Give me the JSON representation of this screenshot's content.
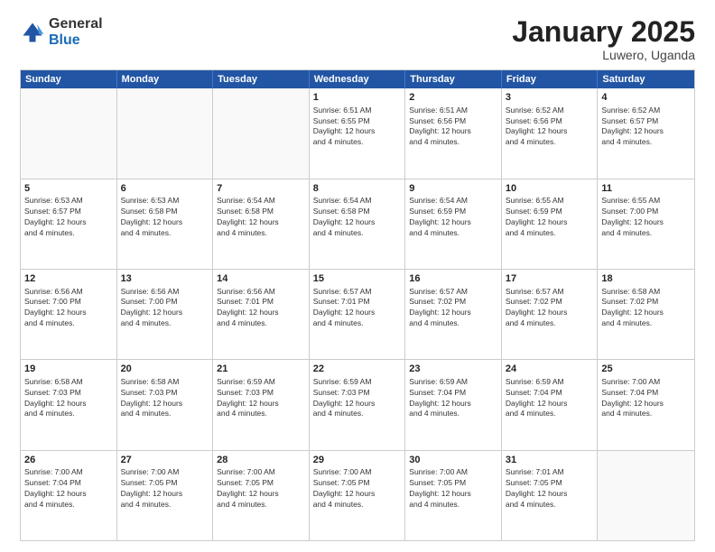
{
  "logo": {
    "general": "General",
    "blue": "Blue"
  },
  "title": {
    "month": "January 2025",
    "location": "Luwero, Uganda"
  },
  "header_days": [
    "Sunday",
    "Monday",
    "Tuesday",
    "Wednesday",
    "Thursday",
    "Friday",
    "Saturday"
  ],
  "rows": [
    [
      {
        "day": "",
        "text": "",
        "empty": true
      },
      {
        "day": "",
        "text": "",
        "empty": true
      },
      {
        "day": "",
        "text": "",
        "empty": true
      },
      {
        "day": "1",
        "text": "Sunrise: 6:51 AM\nSunset: 6:55 PM\nDaylight: 12 hours\nand 4 minutes."
      },
      {
        "day": "2",
        "text": "Sunrise: 6:51 AM\nSunset: 6:56 PM\nDaylight: 12 hours\nand 4 minutes."
      },
      {
        "day": "3",
        "text": "Sunrise: 6:52 AM\nSunset: 6:56 PM\nDaylight: 12 hours\nand 4 minutes."
      },
      {
        "day": "4",
        "text": "Sunrise: 6:52 AM\nSunset: 6:57 PM\nDaylight: 12 hours\nand 4 minutes."
      }
    ],
    [
      {
        "day": "5",
        "text": "Sunrise: 6:53 AM\nSunset: 6:57 PM\nDaylight: 12 hours\nand 4 minutes."
      },
      {
        "day": "6",
        "text": "Sunrise: 6:53 AM\nSunset: 6:58 PM\nDaylight: 12 hours\nand 4 minutes."
      },
      {
        "day": "7",
        "text": "Sunrise: 6:54 AM\nSunset: 6:58 PM\nDaylight: 12 hours\nand 4 minutes."
      },
      {
        "day": "8",
        "text": "Sunrise: 6:54 AM\nSunset: 6:58 PM\nDaylight: 12 hours\nand 4 minutes."
      },
      {
        "day": "9",
        "text": "Sunrise: 6:54 AM\nSunset: 6:59 PM\nDaylight: 12 hours\nand 4 minutes."
      },
      {
        "day": "10",
        "text": "Sunrise: 6:55 AM\nSunset: 6:59 PM\nDaylight: 12 hours\nand 4 minutes."
      },
      {
        "day": "11",
        "text": "Sunrise: 6:55 AM\nSunset: 7:00 PM\nDaylight: 12 hours\nand 4 minutes."
      }
    ],
    [
      {
        "day": "12",
        "text": "Sunrise: 6:56 AM\nSunset: 7:00 PM\nDaylight: 12 hours\nand 4 minutes."
      },
      {
        "day": "13",
        "text": "Sunrise: 6:56 AM\nSunset: 7:00 PM\nDaylight: 12 hours\nand 4 minutes."
      },
      {
        "day": "14",
        "text": "Sunrise: 6:56 AM\nSunset: 7:01 PM\nDaylight: 12 hours\nand 4 minutes."
      },
      {
        "day": "15",
        "text": "Sunrise: 6:57 AM\nSunset: 7:01 PM\nDaylight: 12 hours\nand 4 minutes."
      },
      {
        "day": "16",
        "text": "Sunrise: 6:57 AM\nSunset: 7:02 PM\nDaylight: 12 hours\nand 4 minutes."
      },
      {
        "day": "17",
        "text": "Sunrise: 6:57 AM\nSunset: 7:02 PM\nDaylight: 12 hours\nand 4 minutes."
      },
      {
        "day": "18",
        "text": "Sunrise: 6:58 AM\nSunset: 7:02 PM\nDaylight: 12 hours\nand 4 minutes."
      }
    ],
    [
      {
        "day": "19",
        "text": "Sunrise: 6:58 AM\nSunset: 7:03 PM\nDaylight: 12 hours\nand 4 minutes."
      },
      {
        "day": "20",
        "text": "Sunrise: 6:58 AM\nSunset: 7:03 PM\nDaylight: 12 hours\nand 4 minutes."
      },
      {
        "day": "21",
        "text": "Sunrise: 6:59 AM\nSunset: 7:03 PM\nDaylight: 12 hours\nand 4 minutes."
      },
      {
        "day": "22",
        "text": "Sunrise: 6:59 AM\nSunset: 7:03 PM\nDaylight: 12 hours\nand 4 minutes."
      },
      {
        "day": "23",
        "text": "Sunrise: 6:59 AM\nSunset: 7:04 PM\nDaylight: 12 hours\nand 4 minutes."
      },
      {
        "day": "24",
        "text": "Sunrise: 6:59 AM\nSunset: 7:04 PM\nDaylight: 12 hours\nand 4 minutes."
      },
      {
        "day": "25",
        "text": "Sunrise: 7:00 AM\nSunset: 7:04 PM\nDaylight: 12 hours\nand 4 minutes."
      }
    ],
    [
      {
        "day": "26",
        "text": "Sunrise: 7:00 AM\nSunset: 7:04 PM\nDaylight: 12 hours\nand 4 minutes."
      },
      {
        "day": "27",
        "text": "Sunrise: 7:00 AM\nSunset: 7:05 PM\nDaylight: 12 hours\nand 4 minutes."
      },
      {
        "day": "28",
        "text": "Sunrise: 7:00 AM\nSunset: 7:05 PM\nDaylight: 12 hours\nand 4 minutes."
      },
      {
        "day": "29",
        "text": "Sunrise: 7:00 AM\nSunset: 7:05 PM\nDaylight: 12 hours\nand 4 minutes."
      },
      {
        "day": "30",
        "text": "Sunrise: 7:00 AM\nSunset: 7:05 PM\nDaylight: 12 hours\nand 4 minutes."
      },
      {
        "day": "31",
        "text": "Sunrise: 7:01 AM\nSunset: 7:05 PM\nDaylight: 12 hours\nand 4 minutes."
      },
      {
        "day": "",
        "text": "",
        "empty": true
      }
    ]
  ]
}
